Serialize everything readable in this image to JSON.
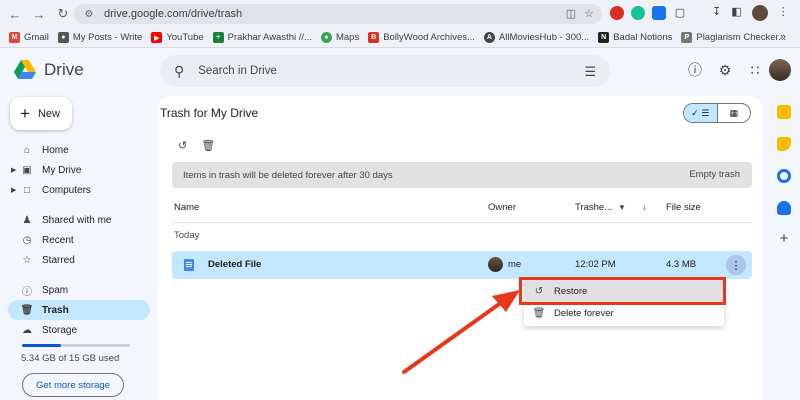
{
  "browser": {
    "url": "drive.google.com/drive/trash",
    "bookmarks": [
      {
        "label": "Gmail",
        "color": "#ea4335"
      },
      {
        "label": "My Posts - Write",
        "color": "#555555"
      },
      {
        "label": "YouTube",
        "color": "#ff0000"
      },
      {
        "label": "Prakhar Awasthi //...",
        "color": "#188038"
      },
      {
        "label": "Maps",
        "color": "#34a853"
      },
      {
        "label": "BollyWood Archives...",
        "color": "#d93025"
      },
      {
        "label": "AllMoviesHub - 300...",
        "color": "#444444"
      },
      {
        "label": "Badal Notions",
        "color": "#222222"
      },
      {
        "label": "Plagiarism Checker...",
        "color": "#777777"
      }
    ],
    "more": "»"
  },
  "app": {
    "name": "Drive",
    "search_placeholder": "Search in Drive"
  },
  "sidebar": {
    "new_label": "New",
    "items": [
      {
        "label": "Home",
        "icon": "home-icon"
      },
      {
        "label": "My Drive",
        "icon": "my-drive-icon"
      },
      {
        "label": "Computers",
        "icon": "computers-icon"
      },
      {
        "label": "Shared with me",
        "icon": "shared-icon"
      },
      {
        "label": "Recent",
        "icon": "recent-icon"
      },
      {
        "label": "Starred",
        "icon": "star-icon"
      },
      {
        "label": "Spam",
        "icon": "spam-icon"
      },
      {
        "label": "Trash",
        "icon": "trash-icon"
      },
      {
        "label": "Storage",
        "icon": "cloud-icon"
      }
    ],
    "storage_used": "5.34 GB of 15 GB used",
    "storage_fraction": 0.36,
    "get_more_storage": "Get more storage"
  },
  "main": {
    "title": "Trash for My Drive",
    "banner_text": "Items in trash will be deleted forever after 30 days",
    "empty_trash": "Empty trash",
    "columns": {
      "name": "Name",
      "owner": "Owner",
      "trashed": "Trashe...",
      "file_size": "File size"
    },
    "group": "Today",
    "file": {
      "name": "Deleted File",
      "owner": "me",
      "trashed_time": "12:02 PM",
      "size": "4.3 MB"
    }
  },
  "context_menu": {
    "restore": "Restore",
    "delete_forever": "Delete forever"
  },
  "colors": {
    "accent": "#0b57d0",
    "selected": "#c2e7ff",
    "annotation": "#e8371c"
  }
}
